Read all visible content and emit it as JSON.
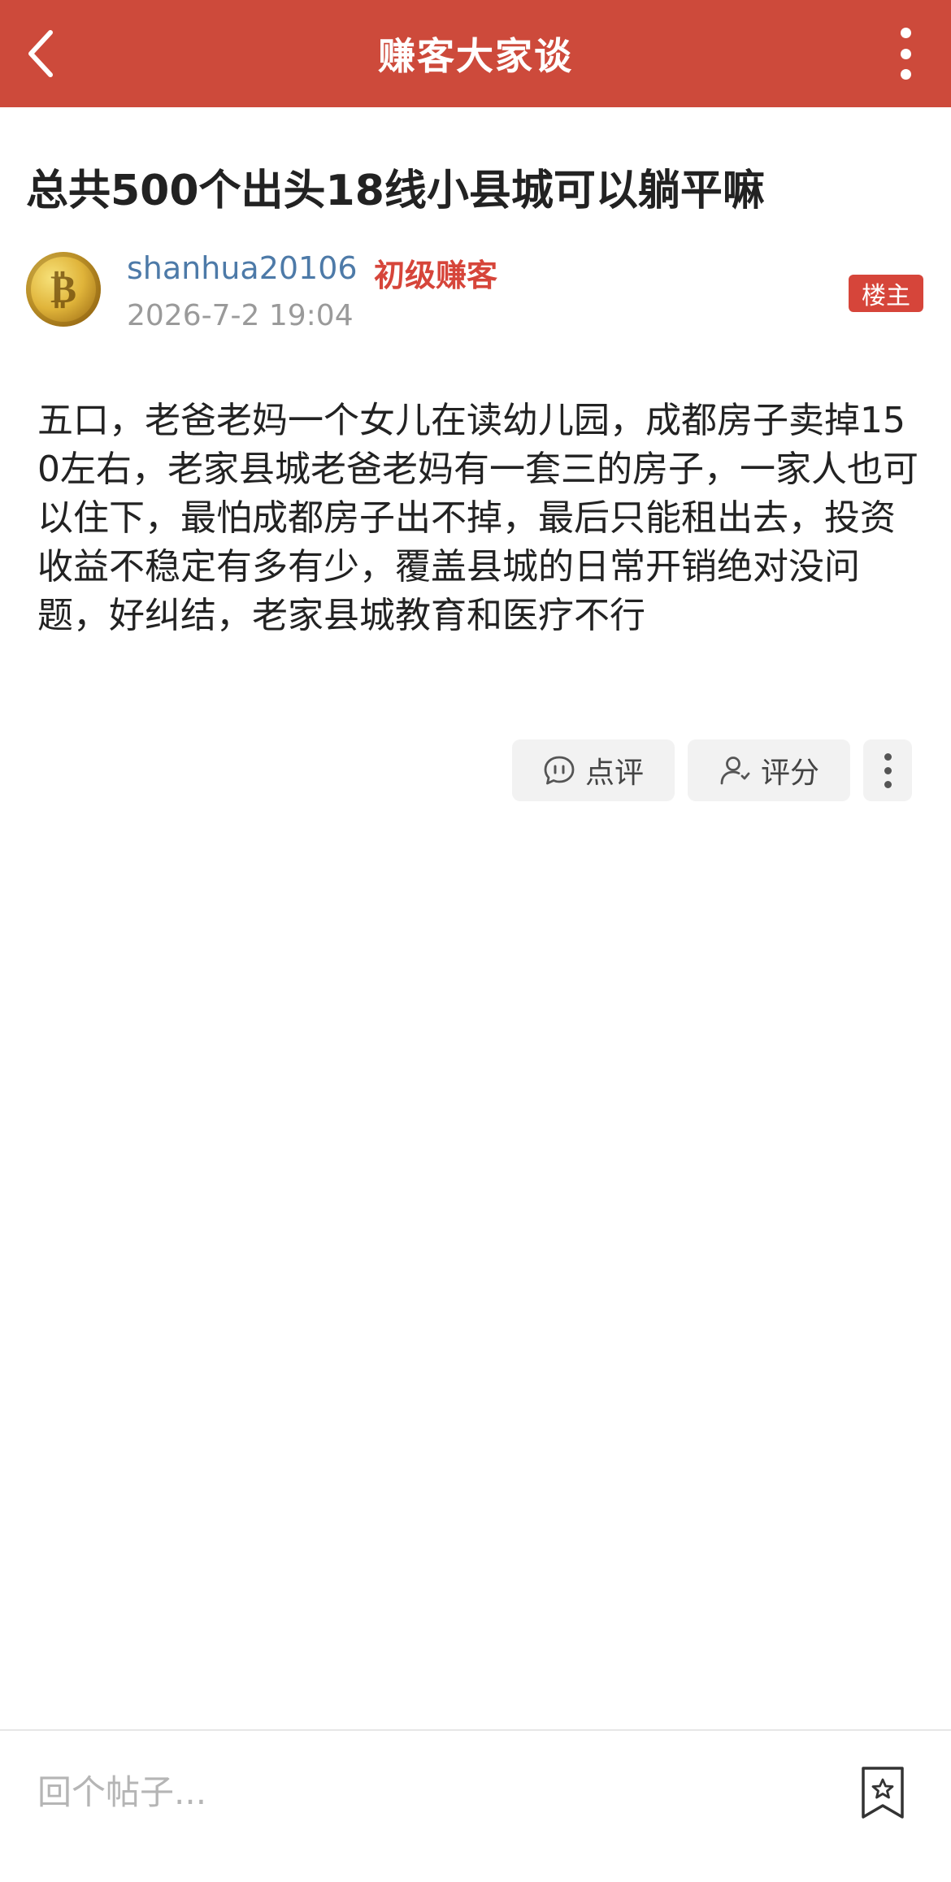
{
  "topbar": {
    "title": "赚客大家谈"
  },
  "post": {
    "title": "总共500个出头18线小县城可以躺平嘛",
    "author": {
      "username": "shanhua20106",
      "level": "初级赚客",
      "time": "2026-7-2 19:04",
      "owner_badge": "楼主"
    },
    "body": "五口，老爸老妈一个女儿在读幼儿园，成都房子卖掉150左右，老家县城老爸老妈有一套三的房子，一家人也可以住下，最怕成都房子出不掉，最后只能租出去，投资收益不稳定有多有少，覆盖县城的日常开销绝对没问题，好纠结，老家县城教育和医疗不行"
  },
  "actions": {
    "comment_label": "点评",
    "rate_label": "评分"
  },
  "reply": {
    "placeholder": "回个帖子..."
  },
  "colors": {
    "brand": "#cd4a3b",
    "username": "#4d7aa8",
    "level": "#d6453a"
  }
}
